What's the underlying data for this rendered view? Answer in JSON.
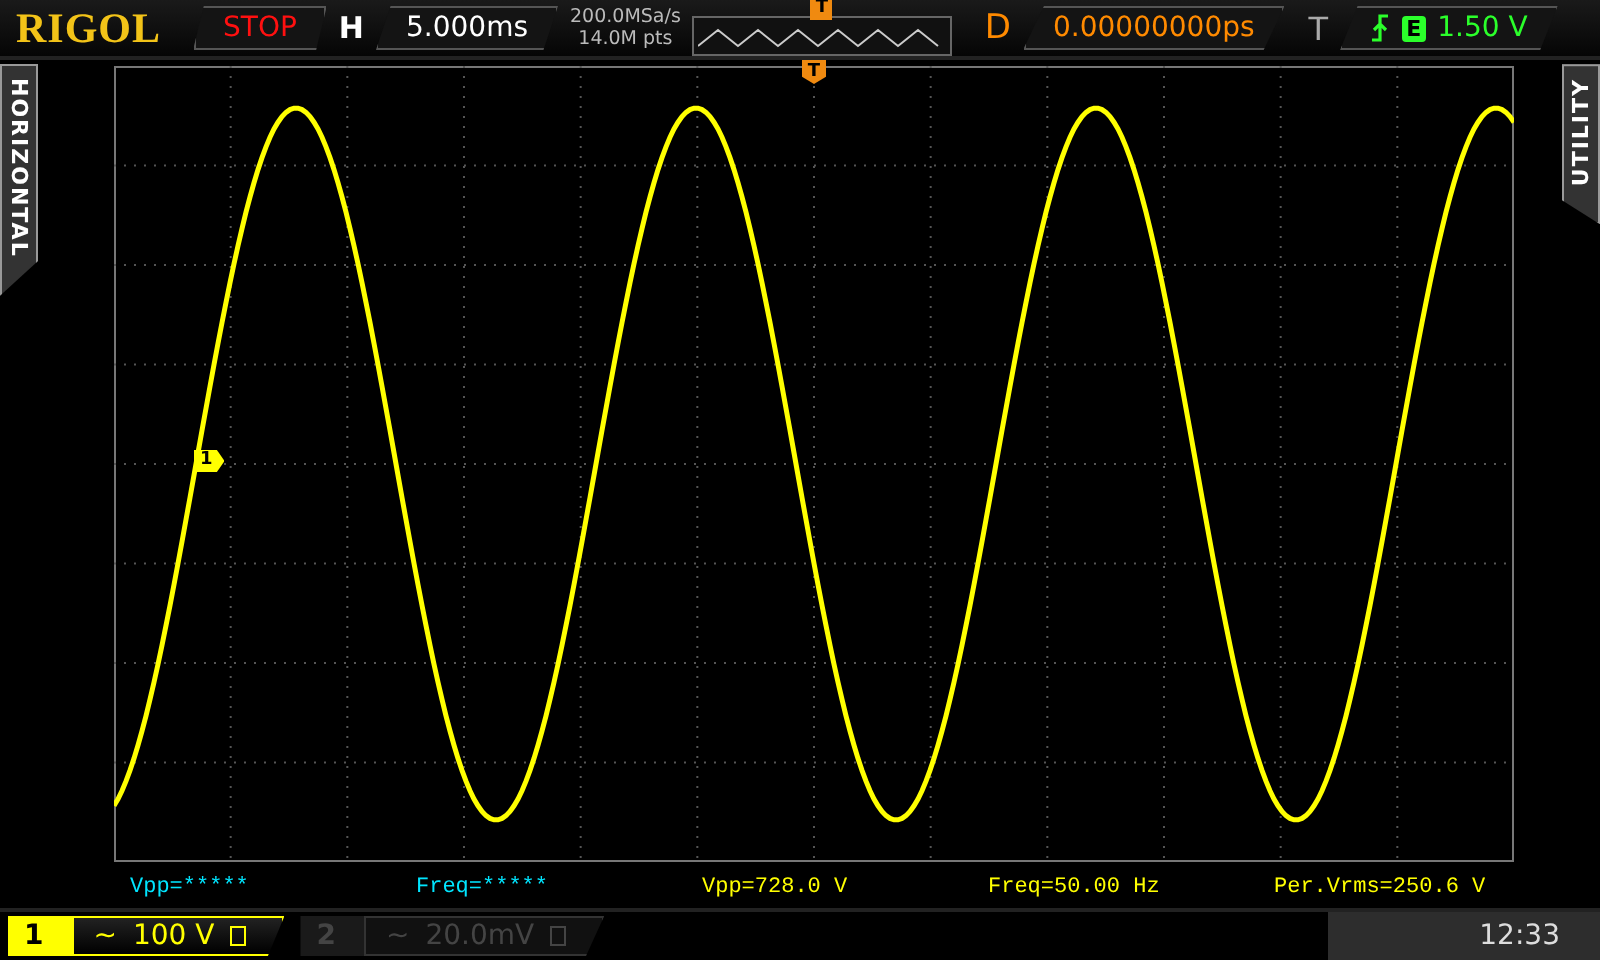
{
  "header": {
    "logo": "RIGOL",
    "run_state": "STOP",
    "timebase_label": "H",
    "timebase": "5.000ms",
    "sample_rate": "200.0MSa/s",
    "memory_depth": "14.0M pts",
    "trigger_position_marker": "T",
    "delay_label": "D",
    "delay": "0.00000000ps",
    "trigger_label": "T",
    "trigger_source": "E",
    "trigger_level": "1.50 V"
  },
  "side_tabs": {
    "left": "HORIZONTAL",
    "right": "UTILITY"
  },
  "screen": {
    "trigger_marker": "T",
    "channel_marker": "1"
  },
  "measurements": [
    {
      "text": "Vpp=*****",
      "color": "#00e5ff"
    },
    {
      "text": "Freq=*****",
      "color": "#00e5ff"
    },
    {
      "text": "Vpp=728.0 V",
      "color": "#ffff00"
    },
    {
      "text": "Freq=50.00 Hz",
      "color": "#ffff00"
    },
    {
      "text": "Per.Vrms=250.6 V",
      "color": "#ffff00"
    }
  ],
  "channels": [
    {
      "number": "1",
      "coupling": "~",
      "scale": "100 V",
      "selected": true
    },
    {
      "number": "2",
      "coupling": "~",
      "scale": "20.0mV",
      "selected": false
    }
  ],
  "clock": "12:33"
}
